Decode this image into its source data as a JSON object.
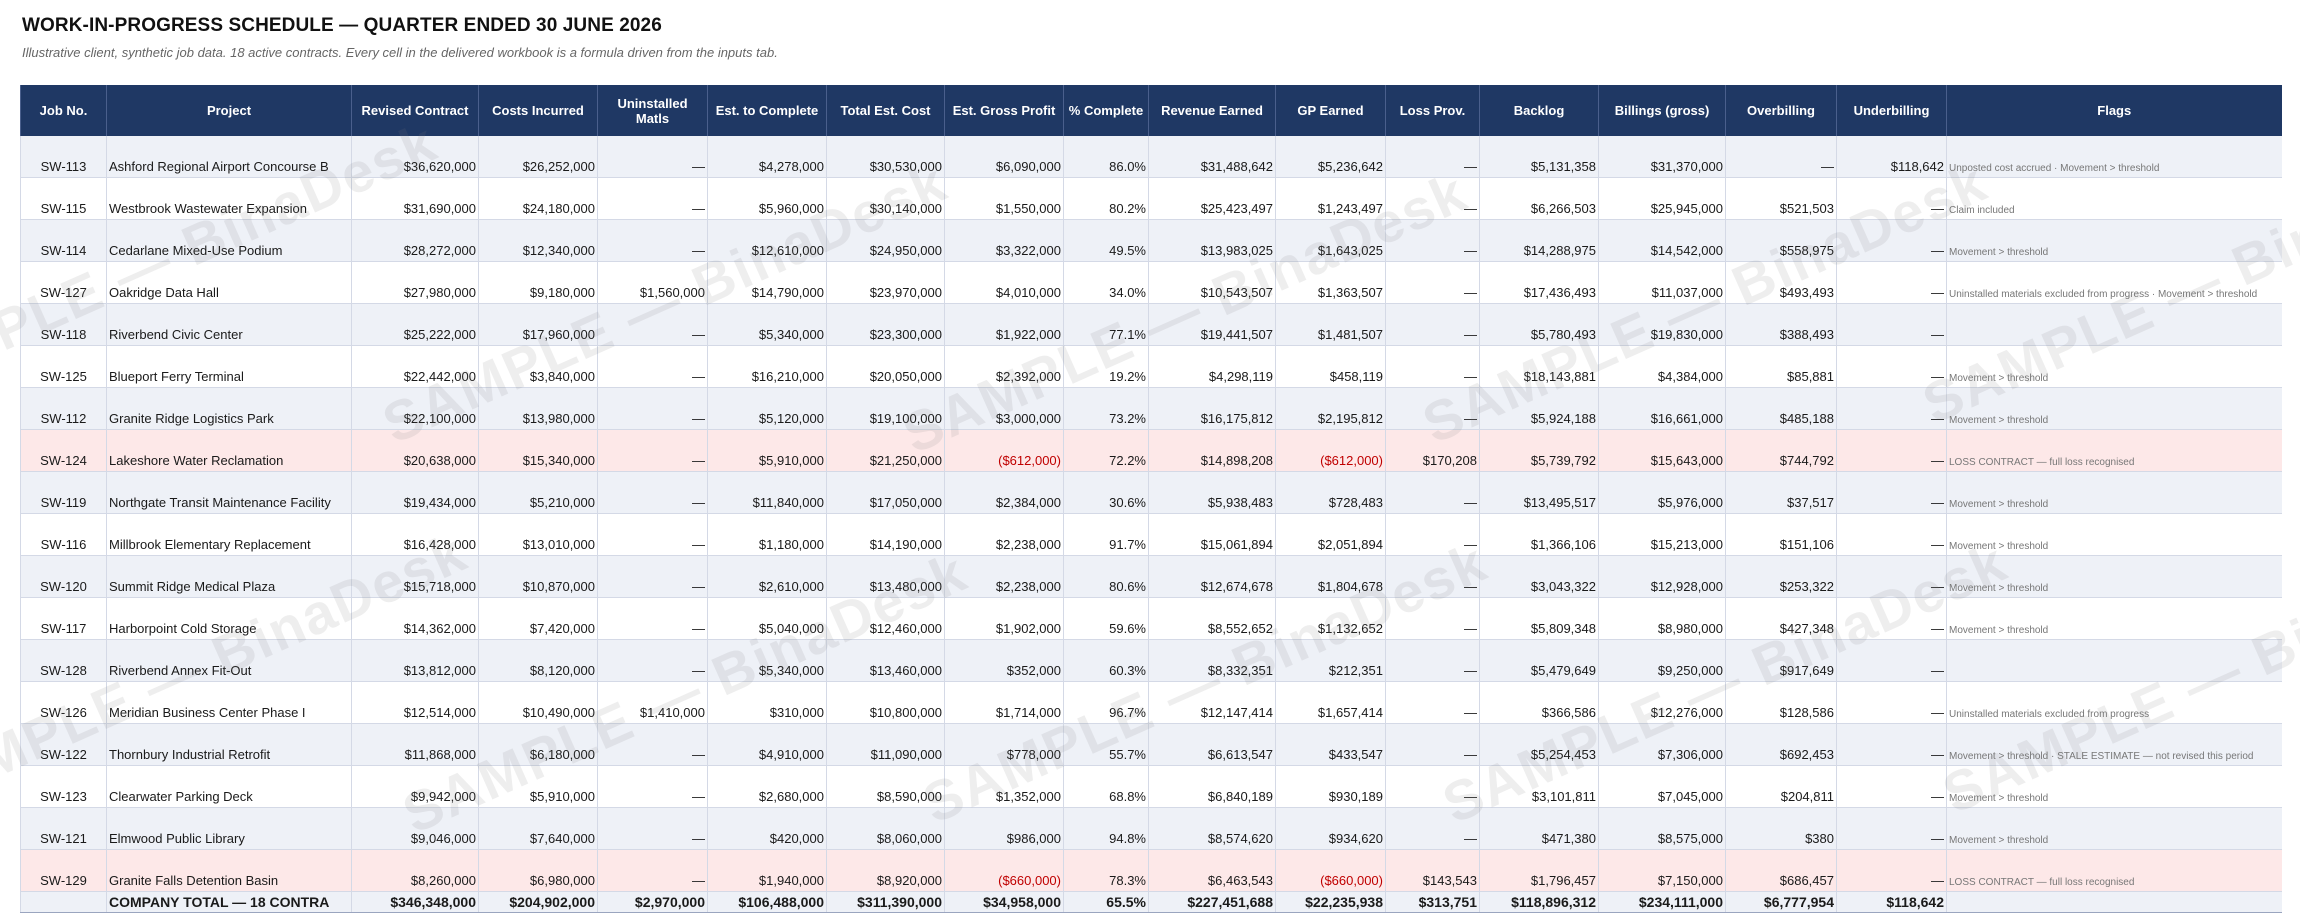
{
  "title": "WORK-IN-PROGRESS SCHEDULE — QUARTER ENDED 30 JUNE 2026",
  "subtitle": "Illustrative client, synthetic job data. 18 active contracts. Every cell in the delivered workbook is a formula driven from the inputs tab.",
  "watermark": "SAMPLE — BinaDesk",
  "columns": {
    "job": "Job No.",
    "project": "Project",
    "revised": "Revised Contract",
    "costs": "Costs Incurred",
    "uninstalled": "Uninstalled Matls",
    "etc": "Est. to Complete",
    "total_cost": "Total Est. Cost",
    "gross_profit": "Est. Gross Profit",
    "pct": "% Complete",
    "revenue": "Revenue Earned",
    "gp_earned": "GP Earned",
    "loss": "Loss Prov.",
    "backlog": "Backlog",
    "billings": "Billings (gross)",
    "overbilling": "Overbilling",
    "underbilling": "Underbilling",
    "flags": "Flags"
  },
  "rows": [
    {
      "job": "SW-113",
      "project": "Ashford Regional Airport Concourse B",
      "revised": "$36,620,000",
      "costs": "$26,252,000",
      "uninstalled": "—",
      "etc": "$4,278,000",
      "total_cost": "$30,530,000",
      "gross_profit": "$6,090,000",
      "pct": "86.0%",
      "revenue": "$31,488,642",
      "gp_earned": "$5,236,642",
      "loss": "—",
      "backlog": "$5,131,358",
      "billings": "$31,370,000",
      "overbilling": "—",
      "underbilling": "$118,642",
      "flags": "Unposted cost accrued · Movement > threshold",
      "status": "normal"
    },
    {
      "job": "SW-115",
      "project": "Westbrook Wastewater Expansion",
      "revised": "$31,690,000",
      "costs": "$24,180,000",
      "uninstalled": "—",
      "etc": "$5,960,000",
      "total_cost": "$30,140,000",
      "gross_profit": "$1,550,000",
      "pct": "80.2%",
      "revenue": "$25,423,497",
      "gp_earned": "$1,243,497",
      "loss": "—",
      "backlog": "$6,266,503",
      "billings": "$25,945,000",
      "overbilling": "$521,503",
      "underbilling": "—",
      "flags": "Claim included",
      "status": "normal"
    },
    {
      "job": "SW-114",
      "project": "Cedarlane Mixed-Use Podium",
      "revised": "$28,272,000",
      "costs": "$12,340,000",
      "uninstalled": "—",
      "etc": "$12,610,000",
      "total_cost": "$24,950,000",
      "gross_profit": "$3,322,000",
      "pct": "49.5%",
      "revenue": "$13,983,025",
      "gp_earned": "$1,643,025",
      "loss": "—",
      "backlog": "$14,288,975",
      "billings": "$14,542,000",
      "overbilling": "$558,975",
      "underbilling": "—",
      "flags": "Movement > threshold",
      "status": "normal"
    },
    {
      "job": "SW-127",
      "project": "Oakridge Data Hall",
      "revised": "$27,980,000",
      "costs": "$9,180,000",
      "uninstalled": "$1,560,000",
      "etc": "$14,790,000",
      "total_cost": "$23,970,000",
      "gross_profit": "$4,010,000",
      "pct": "34.0%",
      "revenue": "$10,543,507",
      "gp_earned": "$1,363,507",
      "loss": "—",
      "backlog": "$17,436,493",
      "billings": "$11,037,000",
      "overbilling": "$493,493",
      "underbilling": "—",
      "flags": "Uninstalled materials excluded from progress · Movement > threshold",
      "status": "normal"
    },
    {
      "job": "SW-118",
      "project": "Riverbend Civic Center",
      "revised": "$25,222,000",
      "costs": "$17,960,000",
      "uninstalled": "—",
      "etc": "$5,340,000",
      "total_cost": "$23,300,000",
      "gross_profit": "$1,922,000",
      "pct": "77.1%",
      "revenue": "$19,441,507",
      "gp_earned": "$1,481,507",
      "loss": "—",
      "backlog": "$5,780,493",
      "billings": "$19,830,000",
      "overbilling": "$388,493",
      "underbilling": "—",
      "flags": "",
      "status": "normal"
    },
    {
      "job": "SW-125",
      "project": "Blueport Ferry Terminal",
      "revised": "$22,442,000",
      "costs": "$3,840,000",
      "uninstalled": "—",
      "etc": "$16,210,000",
      "total_cost": "$20,050,000",
      "gross_profit": "$2,392,000",
      "pct": "19.2%",
      "revenue": "$4,298,119",
      "gp_earned": "$458,119",
      "loss": "—",
      "backlog": "$18,143,881",
      "billings": "$4,384,000",
      "overbilling": "$85,881",
      "underbilling": "—",
      "flags": "Movement > threshold",
      "status": "normal"
    },
    {
      "job": "SW-112",
      "project": "Granite Ridge Logistics Park",
      "revised": "$22,100,000",
      "costs": "$13,980,000",
      "uninstalled": "—",
      "etc": "$5,120,000",
      "total_cost": "$19,100,000",
      "gross_profit": "$3,000,000",
      "pct": "73.2%",
      "revenue": "$16,175,812",
      "gp_earned": "$2,195,812",
      "loss": "—",
      "backlog": "$5,924,188",
      "billings": "$16,661,000",
      "overbilling": "$485,188",
      "underbilling": "—",
      "flags": "Movement > threshold",
      "status": "normal"
    },
    {
      "job": "SW-124",
      "project": "Lakeshore Water Reclamation",
      "revised": "$20,638,000",
      "costs": "$15,340,000",
      "uninstalled": "—",
      "etc": "$5,910,000",
      "total_cost": "$21,250,000",
      "gross_profit": "($612,000)",
      "pct": "72.2%",
      "revenue": "$14,898,208",
      "gp_earned": "($612,000)",
      "loss": "$170,208",
      "backlog": "$5,739,792",
      "billings": "$15,643,000",
      "overbilling": "$744,792",
      "underbilling": "—",
      "flags": "LOSS CONTRACT — full loss recognised",
      "status": "loss"
    },
    {
      "job": "SW-119",
      "project": "Northgate Transit Maintenance Facility",
      "revised": "$19,434,000",
      "costs": "$5,210,000",
      "uninstalled": "—",
      "etc": "$11,840,000",
      "total_cost": "$17,050,000",
      "gross_profit": "$2,384,000",
      "pct": "30.6%",
      "revenue": "$5,938,483",
      "gp_earned": "$728,483",
      "loss": "—",
      "backlog": "$13,495,517",
      "billings": "$5,976,000",
      "overbilling": "$37,517",
      "underbilling": "—",
      "flags": "Movement > threshold",
      "status": "normal"
    },
    {
      "job": "SW-116",
      "project": "Millbrook Elementary Replacement",
      "revised": "$16,428,000",
      "costs": "$13,010,000",
      "uninstalled": "—",
      "etc": "$1,180,000",
      "total_cost": "$14,190,000",
      "gross_profit": "$2,238,000",
      "pct": "91.7%",
      "revenue": "$15,061,894",
      "gp_earned": "$2,051,894",
      "loss": "—",
      "backlog": "$1,366,106",
      "billings": "$15,213,000",
      "overbilling": "$151,106",
      "underbilling": "—",
      "flags": "Movement > threshold",
      "status": "normal"
    },
    {
      "job": "SW-120",
      "project": "Summit Ridge Medical Plaza",
      "revised": "$15,718,000",
      "costs": "$10,870,000",
      "uninstalled": "—",
      "etc": "$2,610,000",
      "total_cost": "$13,480,000",
      "gross_profit": "$2,238,000",
      "pct": "80.6%",
      "revenue": "$12,674,678",
      "gp_earned": "$1,804,678",
      "loss": "—",
      "backlog": "$3,043,322",
      "billings": "$12,928,000",
      "overbilling": "$253,322",
      "underbilling": "—",
      "flags": "Movement > threshold",
      "status": "normal"
    },
    {
      "job": "SW-117",
      "project": "Harborpoint Cold Storage",
      "revised": "$14,362,000",
      "costs": "$7,420,000",
      "uninstalled": "—",
      "etc": "$5,040,000",
      "total_cost": "$12,460,000",
      "gross_profit": "$1,902,000",
      "pct": "59.6%",
      "revenue": "$8,552,652",
      "gp_earned": "$1,132,652",
      "loss": "—",
      "backlog": "$5,809,348",
      "billings": "$8,980,000",
      "overbilling": "$427,348",
      "underbilling": "—",
      "flags": "Movement > threshold",
      "status": "normal"
    },
    {
      "job": "SW-128",
      "project": "Riverbend Annex Fit-Out",
      "revised": "$13,812,000",
      "costs": "$8,120,000",
      "uninstalled": "—",
      "etc": "$5,340,000",
      "total_cost": "$13,460,000",
      "gross_profit": "$352,000",
      "pct": "60.3%",
      "revenue": "$8,332,351",
      "gp_earned": "$212,351",
      "loss": "—",
      "backlog": "$5,479,649",
      "billings": "$9,250,000",
      "overbilling": "$917,649",
      "underbilling": "—",
      "flags": "",
      "status": "normal"
    },
    {
      "job": "SW-126",
      "project": "Meridian Business Center Phase I",
      "revised": "$12,514,000",
      "costs": "$10,490,000",
      "uninstalled": "$1,410,000",
      "etc": "$310,000",
      "total_cost": "$10,800,000",
      "gross_profit": "$1,714,000",
      "pct": "96.7%",
      "revenue": "$12,147,414",
      "gp_earned": "$1,657,414",
      "loss": "—",
      "backlog": "$366,586",
      "billings": "$12,276,000",
      "overbilling": "$128,586",
      "underbilling": "—",
      "flags": "Uninstalled materials excluded from progress",
      "status": "normal"
    },
    {
      "job": "SW-122",
      "project": "Thornbury Industrial Retrofit",
      "revised": "$11,868,000",
      "costs": "$6,180,000",
      "uninstalled": "—",
      "etc": "$4,910,000",
      "total_cost": "$11,090,000",
      "gross_profit": "$778,000",
      "pct": "55.7%",
      "revenue": "$6,613,547",
      "gp_earned": "$433,547",
      "loss": "—",
      "backlog": "$5,254,453",
      "billings": "$7,306,000",
      "overbilling": "$692,453",
      "underbilling": "—",
      "flags": "Movement > threshold · STALE ESTIMATE — not revised this period",
      "status": "normal"
    },
    {
      "job": "SW-123",
      "project": "Clearwater Parking Deck",
      "revised": "$9,942,000",
      "costs": "$5,910,000",
      "uninstalled": "—",
      "etc": "$2,680,000",
      "total_cost": "$8,590,000",
      "gross_profit": "$1,352,000",
      "pct": "68.8%",
      "revenue": "$6,840,189",
      "gp_earned": "$930,189",
      "loss": "—",
      "backlog": "$3,101,811",
      "billings": "$7,045,000",
      "overbilling": "$204,811",
      "underbilling": "—",
      "flags": "Movement > threshold",
      "status": "normal"
    },
    {
      "job": "SW-121",
      "project": "Elmwood Public Library",
      "revised": "$9,046,000",
      "costs": "$7,640,000",
      "uninstalled": "—",
      "etc": "$420,000",
      "total_cost": "$8,060,000",
      "gross_profit": "$986,000",
      "pct": "94.8%",
      "revenue": "$8,574,620",
      "gp_earned": "$934,620",
      "loss": "—",
      "backlog": "$471,380",
      "billings": "$8,575,000",
      "overbilling": "$380",
      "underbilling": "—",
      "flags": "Movement > threshold",
      "status": "normal"
    },
    {
      "job": "SW-129",
      "project": "Granite Falls Detention Basin",
      "revised": "$8,260,000",
      "costs": "$6,980,000",
      "uninstalled": "—",
      "etc": "$1,940,000",
      "total_cost": "$8,920,000",
      "gross_profit": "($660,000)",
      "pct": "78.3%",
      "revenue": "$6,463,543",
      "gp_earned": "($660,000)",
      "loss": "$143,543",
      "backlog": "$1,796,457",
      "billings": "$7,150,000",
      "overbilling": "$686,457",
      "underbilling": "—",
      "flags": "LOSS CONTRACT — full loss recognised",
      "status": "loss"
    }
  ],
  "total": {
    "job": "",
    "project": "COMPANY TOTAL — 18 CONTRA",
    "revised": "$346,348,000",
    "costs": "$204,902,000",
    "uninstalled": "$2,970,000",
    "etc": "$106,488,000",
    "total_cost": "$311,390,000",
    "gross_profit": "$34,958,000",
    "pct": "65.5%",
    "revenue": "$227,451,688",
    "gp_earned": "$22,235,938",
    "loss": "$313,751",
    "backlog": "$118,896,312",
    "billings": "$234,111,000",
    "overbilling": "$6,777,954",
    "underbilling": "$118,642",
    "flags": ""
  },
  "colors": {
    "header_bg": "#1f3864",
    "band": "#eef1f7",
    "loss_row": "#fde8e8",
    "negative_text": "#c00000"
  }
}
